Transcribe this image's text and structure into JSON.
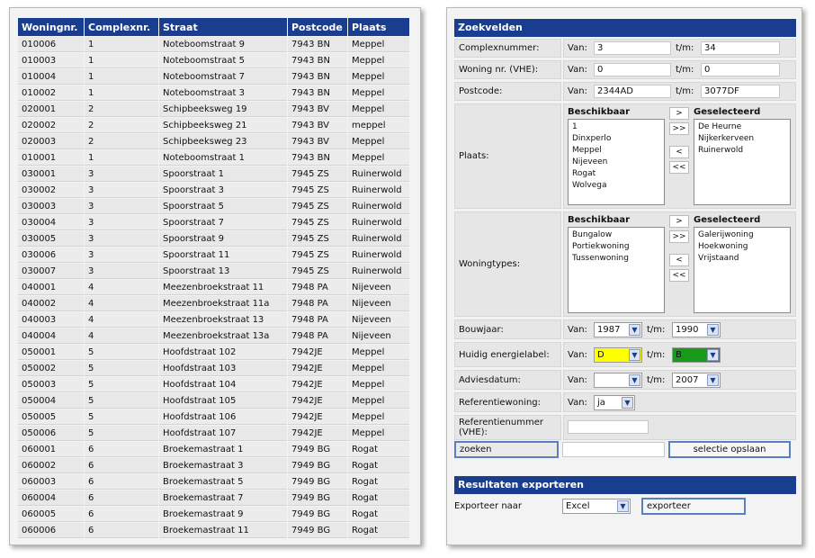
{
  "table": {
    "headers": [
      "Woningnr.",
      "Complexnr.",
      "Straat",
      "Postcode",
      "Plaats"
    ],
    "rows": [
      [
        "010006",
        "1",
        "Noteboomstraat 9",
        "7943 BN",
        "Meppel"
      ],
      [
        "010003",
        "1",
        "Noteboomstraat 5",
        "7943 BN",
        "Meppel"
      ],
      [
        "010004",
        "1",
        "Noteboomstraat 7",
        "7943 BN",
        "Meppel"
      ],
      [
        "010002",
        "1",
        "Noteboomstraat 3",
        "7943 BN",
        "Meppel"
      ],
      [
        "020001",
        "2",
        "Schipbeeksweg 19",
        "7943 BV",
        "Meppel"
      ],
      [
        "020002",
        "2",
        "Schipbeeksweg 21",
        "7943 BV",
        "meppel"
      ],
      [
        "020003",
        "2",
        "Schipbeeksweg 23",
        "7943 BV",
        "Meppel"
      ],
      [
        "010001",
        "1",
        "Noteboomstraat 1",
        "7943 BN",
        "Meppel"
      ],
      [
        "030001",
        "3",
        "Spoorstraat 1",
        "7945 ZS",
        "Ruinerwold"
      ],
      [
        "030002",
        "3",
        "Spoorstraat 3",
        "7945 ZS",
        "Ruinerwold"
      ],
      [
        "030003",
        "3",
        "Spoorstraat 5",
        "7945 ZS",
        "Ruinerwold"
      ],
      [
        "030004",
        "3",
        "Spoorstraat 7",
        "7945 ZS",
        "Ruinerwold"
      ],
      [
        "030005",
        "3",
        "Spoorstraat 9",
        "7945 ZS",
        "Ruinerwold"
      ],
      [
        "030006",
        "3",
        "Spoorstraat 11",
        "7945 ZS",
        "Ruinerwold"
      ],
      [
        "030007",
        "3",
        "Spoorstraat 13",
        "7945 ZS",
        "Ruinerwold"
      ],
      [
        "040001",
        "4",
        "Meezenbroekstraat 11",
        "7948 PA",
        "Nijeveen"
      ],
      [
        "040002",
        "4",
        "Meezenbroekstraat 11a",
        "7948 PA",
        "Nijeveen"
      ],
      [
        "040003",
        "4",
        "Meezenbroekstraat 13",
        "7948 PA",
        "Nijeveen"
      ],
      [
        "040004",
        "4",
        "Meezenbroekstraat 13a",
        "7948 PA",
        "Nijeveen"
      ],
      [
        "050001",
        "5",
        "Hoofdstraat 102",
        "7942JE",
        "Meppel"
      ],
      [
        "050002",
        "5",
        "Hoofdstraat 103",
        "7942JE",
        "Meppel"
      ],
      [
        "050003",
        "5",
        "Hoofdstraat 104",
        "7942JE",
        "Meppel"
      ],
      [
        "050004",
        "5",
        "Hoofdstraat 105",
        "7942JE",
        "Meppel"
      ],
      [
        "050005",
        "5",
        "Hoofdstraat 106",
        "7942JE",
        "Meppel"
      ],
      [
        "050006",
        "5",
        "Hoofdstraat 107",
        "7942JE",
        "Meppel"
      ],
      [
        "060001",
        "6",
        "Broekemastraat 1",
        "7949 BG",
        "Rogat"
      ],
      [
        "060002",
        "6",
        "Broekemastraat 3",
        "7949 BG",
        "Rogat"
      ],
      [
        "060003",
        "6",
        "Broekemastraat 5",
        "7949 BG",
        "Rogat"
      ],
      [
        "060004",
        "6",
        "Broekemastraat 7",
        "7949 BG",
        "Rogat"
      ],
      [
        "060005",
        "6",
        "Broekemastraat 9",
        "7949 BG",
        "Rogat"
      ],
      [
        "060006",
        "6",
        "Broekemastraat 11",
        "7949 BG",
        "Rogat"
      ]
    ]
  },
  "search": {
    "title": "Zoekvelden",
    "van_label": "Van:",
    "tm_label": "t/m:",
    "complex": {
      "label": "Complexnummer:",
      "from": "3",
      "to": "34"
    },
    "woning": {
      "label": "Woning nr. (VHE):",
      "from": "0",
      "to": "0"
    },
    "postcode": {
      "label": "Postcode:",
      "from": "2344AD",
      "to": "3077DF"
    },
    "plaats": {
      "label": "Plaats:",
      "available_header": "Beschikbaar",
      "selected_header": "Geselecteerd",
      "available": [
        "1",
        "Dinxperlo",
        "Meppel",
        "Nijeveen",
        "Rogat",
        "Wolvega"
      ],
      "selected": [
        "De Heurne",
        "Nijkerkerveen",
        "Ruinerwold"
      ]
    },
    "woningtypes": {
      "label": "Woningtypes:",
      "available_header": "Beschikbaar",
      "selected_header": "Geselecteerd",
      "available": [
        "Bungalow",
        "Portiekwoning",
        "Tussenwoning"
      ],
      "selected": [
        "Galerijwoning",
        "Hoekwoning",
        "Vrijstaand"
      ]
    },
    "move_buttons": {
      "right": ">",
      "all_right": ">>",
      "left": "<",
      "all_left": "<<"
    },
    "bouwjaar": {
      "label": "Bouwjaar:",
      "from": "1987",
      "to": "1990"
    },
    "energielabel": {
      "label": "Huidig energielabel:",
      "from": "D",
      "to": "B",
      "from_color": "#ffff00",
      "to_color": "#1a9a1a"
    },
    "adviesdatum": {
      "label": "Adviesdatum:",
      "from": "",
      "to": "2007"
    },
    "referentiewoning": {
      "label": "Referentiewoning:",
      "value": "ja"
    },
    "referentienummer": {
      "label": "Referentienummer (VHE):",
      "value": ""
    },
    "zoeken_value": "zoeken",
    "middle_input_value": "",
    "save_button": "selectie opslaan"
  },
  "export": {
    "title": "Resultaten exporteren",
    "label": "Exporteer naar",
    "format": "Excel",
    "button_value": "exporteer"
  }
}
